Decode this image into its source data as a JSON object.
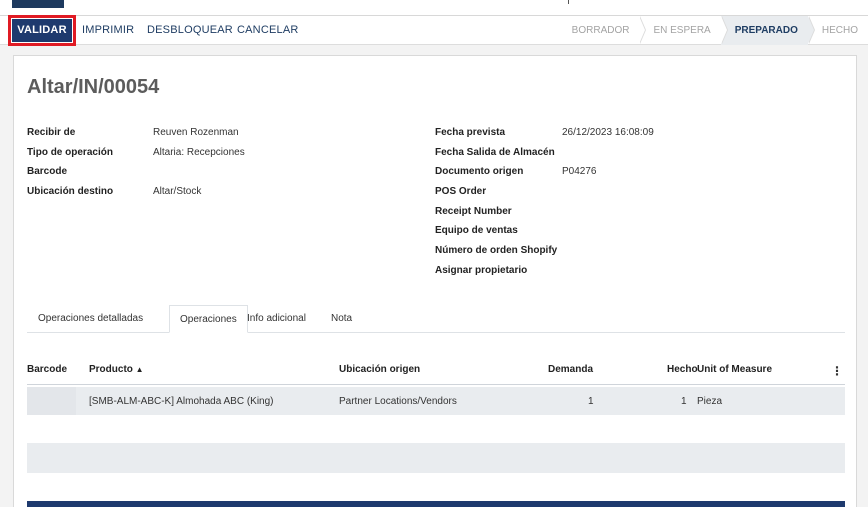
{
  "toolbar": {
    "validate_label": "VALIDAR",
    "print_label": "IMPRIMIR",
    "unlock_label": "DESBLOQUEAR",
    "cancel_label": "CANCELAR"
  },
  "status": {
    "stages": [
      "BORRADOR",
      "EN ESPERA",
      "PREPARADO",
      "HECHO"
    ],
    "active": "PREPARADO"
  },
  "record": {
    "title": "Altar/IN/00054",
    "left_fields": [
      {
        "label": "Recibir de",
        "value": "Reuven Rozenman"
      },
      {
        "label": "Tipo de operación",
        "value": "Altaria: Recepciones"
      },
      {
        "label": "Barcode",
        "value": ""
      },
      {
        "label": "Ubicación destino",
        "value": "Altar/Stock"
      }
    ],
    "right_fields": [
      {
        "label": "Fecha prevista",
        "value": "26/12/2023 16:08:09"
      },
      {
        "label": "Fecha Salida de Almacén",
        "value": ""
      },
      {
        "label": "Documento origen",
        "value": "P04276"
      },
      {
        "label": "POS Order",
        "value": ""
      },
      {
        "label": "Receipt Number",
        "value": ""
      },
      {
        "label": "Equipo de ventas",
        "value": ""
      },
      {
        "label": "Número de orden Shopify",
        "value": ""
      },
      {
        "label": "Asignar propietario",
        "value": ""
      }
    ]
  },
  "tabs": {
    "items": [
      "Operaciones detalladas",
      "Operaciones",
      "Info adicional",
      "Nota"
    ],
    "active": "Operaciones"
  },
  "table": {
    "columns": {
      "barcode": "Barcode",
      "product": "Producto",
      "source": "Ubicación origen",
      "demand": "Demanda",
      "done": "Hecho",
      "uom": "Unit of Measure"
    },
    "sort_indicator": "▲",
    "menu_icon": "⋮",
    "rows": [
      {
        "barcode": "",
        "product": "[SMB-ALM-ABC-K] Almohada ABC (King)",
        "source": "Partner Locations/Vendors",
        "demand": "1",
        "done": "1",
        "uom": "Pieza"
      }
    ]
  },
  "colors": {
    "primary": "#1e3a6e",
    "highlight": "#e01b24",
    "row_bg": "#e9ecef"
  }
}
